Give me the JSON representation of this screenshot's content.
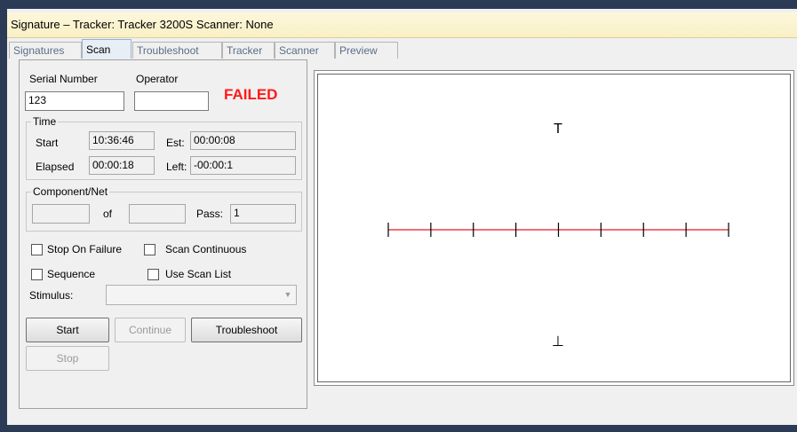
{
  "window": {
    "title": "Signature – Tracker: Tracker 3200S  Scanner: None"
  },
  "tabs": [
    "Signatures",
    "Scan",
    "Troubleshoot",
    "Tracker",
    "Scanner",
    "Preview"
  ],
  "active_tab": "Scan",
  "left_panel": {
    "serial_number_label": "Serial Number",
    "serial_number_value": "123",
    "operator_label": "Operator",
    "operator_value": "",
    "status_text": "FAILED",
    "status_color": "#ff1a1a",
    "time_group": {
      "label": "Time",
      "start_label": "Start",
      "start_value": "10:36:46",
      "est_label": "Est:",
      "est_value": "00:00:08",
      "elapsed_label": "Elapsed",
      "elapsed_value": "00:00:18",
      "left_label": "Left:",
      "left_value": "-00:00:1"
    },
    "component_group": {
      "label": "Component/Net",
      "of_label": "of",
      "pass_label": "Pass:",
      "pass_value": "1"
    },
    "options": {
      "stop_on_failure": "Stop On Failure",
      "scan_continuous": "Scan Continuous",
      "sequence": "Sequence",
      "use_scan_list": "Use Scan List"
    },
    "stimulus_label": "Stimulus:",
    "buttons": {
      "start": "Start",
      "continue": "Continue",
      "troubleshoot": "Troubleshoot",
      "stop": "Stop"
    }
  },
  "scan_display": {
    "top_marker": "T",
    "bottom_marker": "⊥",
    "trace_color": "#e31b23",
    "tick_color": "#000000"
  }
}
